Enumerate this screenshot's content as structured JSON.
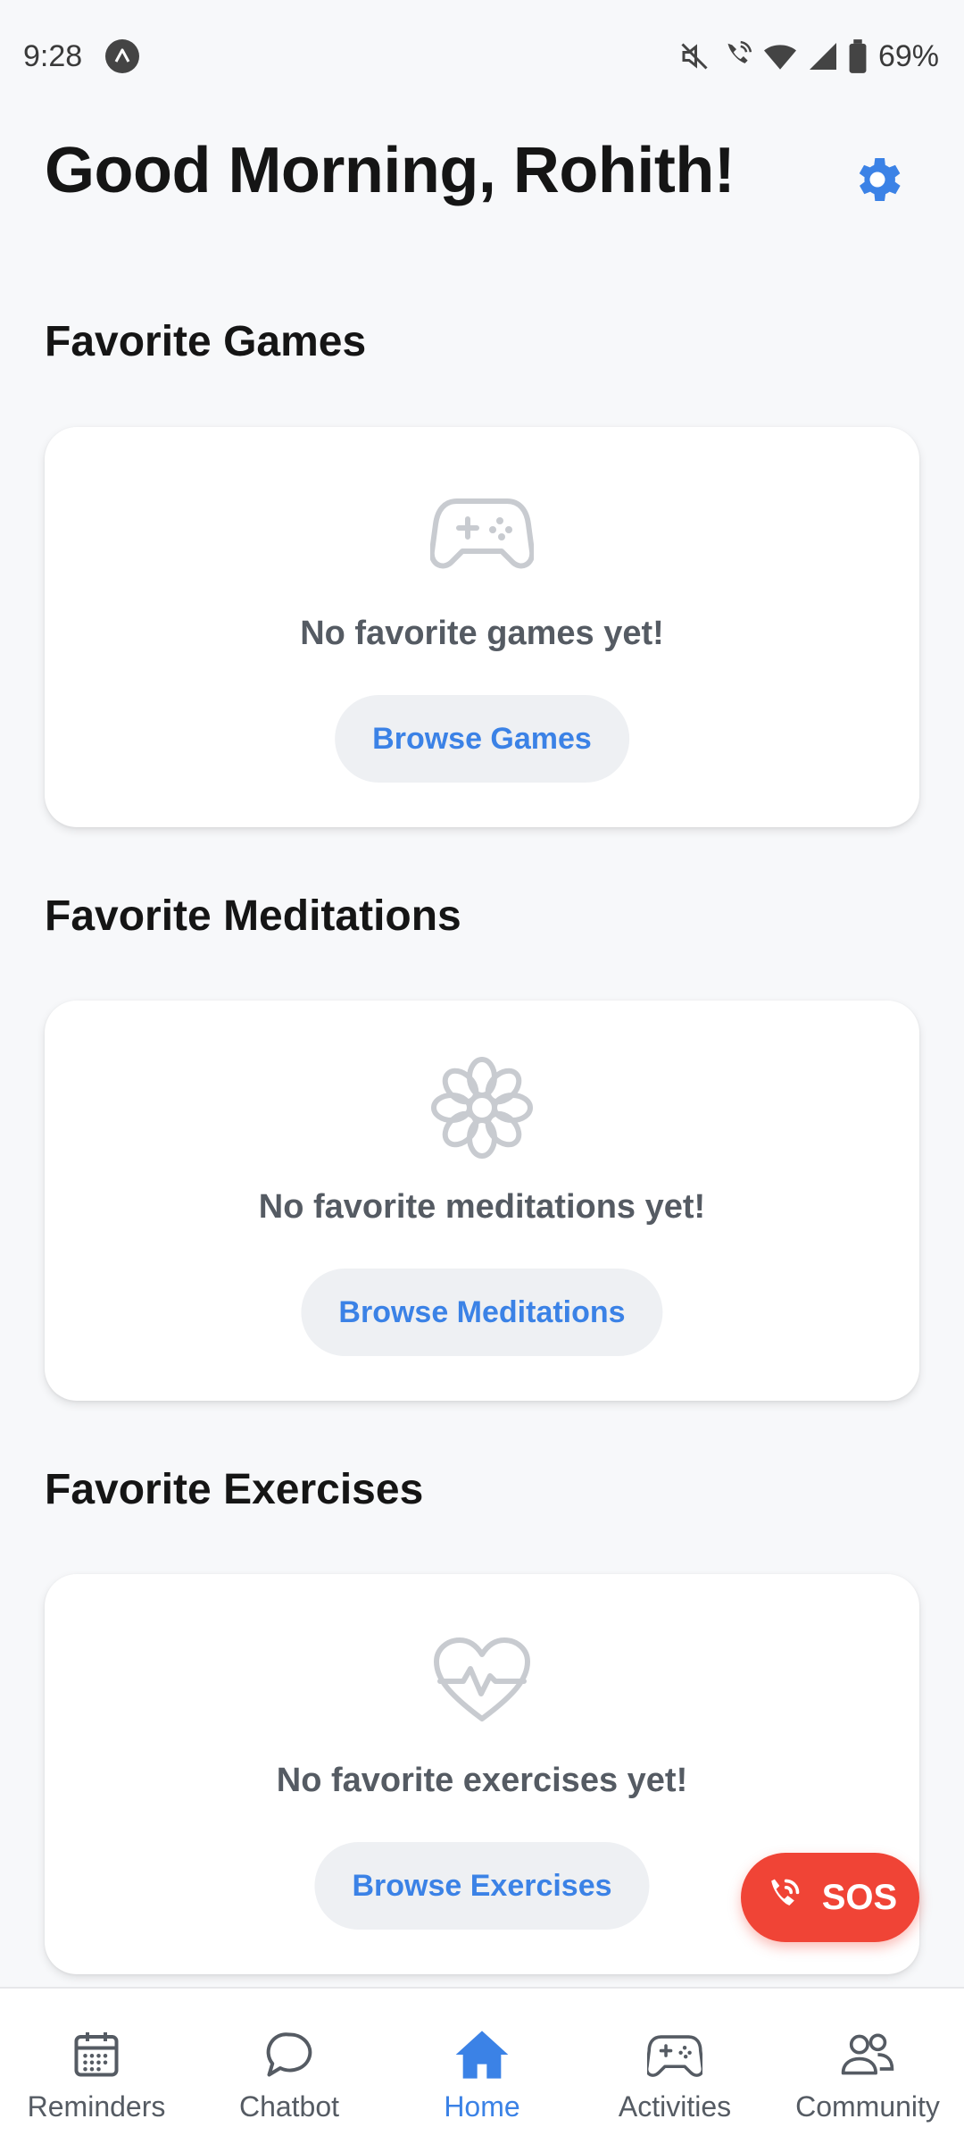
{
  "status_bar": {
    "time": "9:28",
    "battery": "69%",
    "icons": [
      "app-notification-icon",
      "mute-icon",
      "wifi-call-icon",
      "wifi-icon",
      "signal-icon",
      "battery-icon"
    ]
  },
  "header": {
    "greeting": "Good Morning, Rohith!",
    "settings_icon": "gear-icon"
  },
  "sections": {
    "games": {
      "title": "Favorite Games",
      "icon": "gamepad-icon",
      "empty_text": "No favorite games yet!",
      "button_label": "Browse Games"
    },
    "meditations": {
      "title": "Favorite Meditations",
      "icon": "flower-icon",
      "empty_text": "No favorite meditations yet!",
      "button_label": "Browse Meditations"
    },
    "exercises": {
      "title": "Favorite Exercises",
      "icon": "heartbeat-icon",
      "empty_text": "No favorite exercises yet!",
      "button_label": "Browse Exercises"
    }
  },
  "sos": {
    "label": "SOS",
    "icon": "phone-icon"
  },
  "bottom_nav": {
    "items": [
      {
        "label": "Reminders",
        "icon": "calendar-icon"
      },
      {
        "label": "Chatbot",
        "icon": "chat-bubble-icon"
      },
      {
        "label": "Home",
        "icon": "home-icon",
        "active": true
      },
      {
        "label": "Activities",
        "icon": "gamepad-icon"
      },
      {
        "label": "Community",
        "icon": "users-icon"
      }
    ]
  },
  "colors": {
    "accent": "#3b82e6",
    "sos": "#f04436",
    "background": "#f7f8fa",
    "muted_text": "#555b63"
  }
}
